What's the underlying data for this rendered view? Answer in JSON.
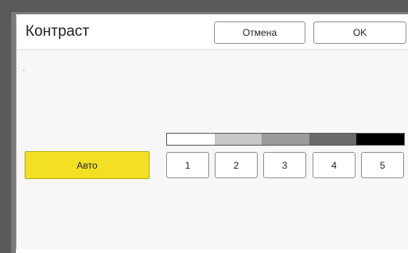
{
  "dialog": {
    "title": "Контраст",
    "cancel_label": "Отмена",
    "ok_label": "OK"
  },
  "contrast": {
    "auto_label": "Авто",
    "auto_color": "#f3e025",
    "scale_colors": [
      "#ffffff",
      "#c8c8c8",
      "#9b9b9b",
      "#6a6a6a",
      "#000000"
    ],
    "levels": [
      "1",
      "2",
      "3",
      "4",
      "5"
    ]
  }
}
